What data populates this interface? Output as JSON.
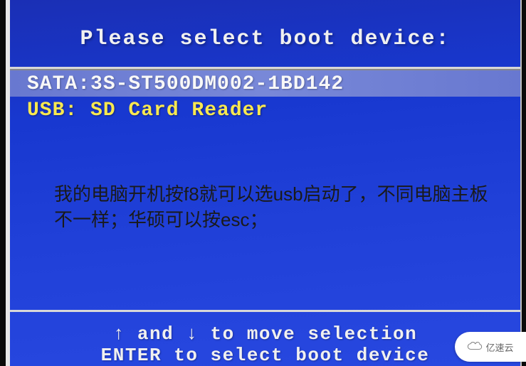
{
  "bios": {
    "title": "Please select boot device:",
    "devices": [
      {
        "label": "SATA:3S-ST500DM002-1BD142",
        "selected": true
      },
      {
        "label": "USB: SD Card Reader",
        "selected": false
      }
    ],
    "footer": {
      "line1": "↑ and ↓ to move selection",
      "line2": "ENTER to select boot device"
    }
  },
  "overlay": {
    "text": "我的电脑开机按f8就可以选usb启动了，不同电脑主板不一样；华硕可以按esc；"
  },
  "watermark": {
    "text": "亿速云"
  }
}
